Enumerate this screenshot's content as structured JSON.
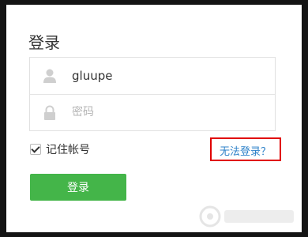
{
  "dialog": {
    "title": "登录",
    "username": {
      "value": "gluupe",
      "icon": "user-icon"
    },
    "password": {
      "placeholder": "密码",
      "icon": "lock-icon"
    },
    "remember": {
      "label": "记住帐号",
      "checked": true
    },
    "forgot_link": "无法登录？",
    "login_button": "登录"
  },
  "colors": {
    "accent_green": "#44b549",
    "link_blue": "#2e82c9",
    "highlight_red": "#e00000",
    "overlay_dark": "#141414"
  }
}
